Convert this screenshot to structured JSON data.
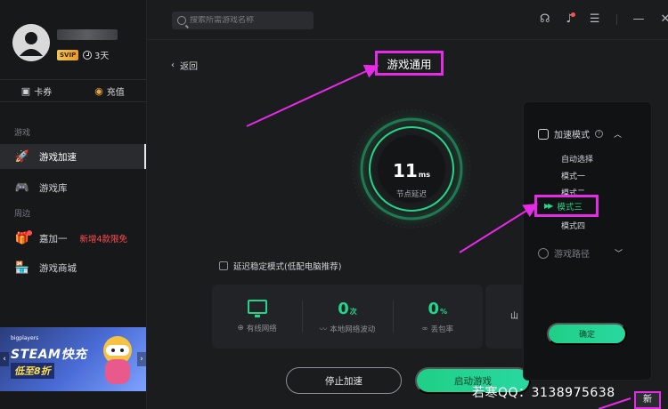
{
  "sidebar": {
    "vip": "SVIP",
    "days": "3天",
    "wallet": {
      "coupon": "卡券",
      "recharge": "充值"
    },
    "section_game": "游戏",
    "section_around": "周边",
    "items": [
      {
        "label": "游戏加速"
      },
      {
        "label": "游戏库"
      },
      {
        "label": "嘉加一",
        "promo": "新增4款限免"
      },
      {
        "label": "游戏商城"
      }
    ],
    "banner": {
      "brand": "bigplayers",
      "title": "STEAM快充",
      "sub": "低至8折"
    }
  },
  "topbar": {
    "search_placeholder": "搜索所需游戏名称"
  },
  "main": {
    "back": "返回",
    "title": "游戏通用",
    "latency": {
      "value": "11",
      "unit": "ms",
      "label": "节点延迟"
    },
    "stable_mode": "延迟稳定模式(低配电脑推荐)",
    "stats": [
      {
        "label": "有线网络"
      },
      {
        "value": "0",
        "unit": "次",
        "label": "本地网络波动"
      },
      {
        "value": "0",
        "unit": "%",
        "label": "丢包率"
      }
    ],
    "partial_stat": "山",
    "stop_button": "停止加速",
    "start_button": "启动游戏"
  },
  "mode_panel": {
    "heading": "加速模式",
    "options": [
      "自动选择",
      "模式一",
      "模式二",
      "模式三",
      "模式四"
    ],
    "selected": "模式三",
    "route_heading": "游戏路径",
    "confirm": "确定"
  },
  "watermark": "若寒QQ：3138975638",
  "corner_label": "新",
  "colors": {
    "accent": "#22d58a",
    "annotation": "#e62be6",
    "promo": "#ff4d4f"
  }
}
